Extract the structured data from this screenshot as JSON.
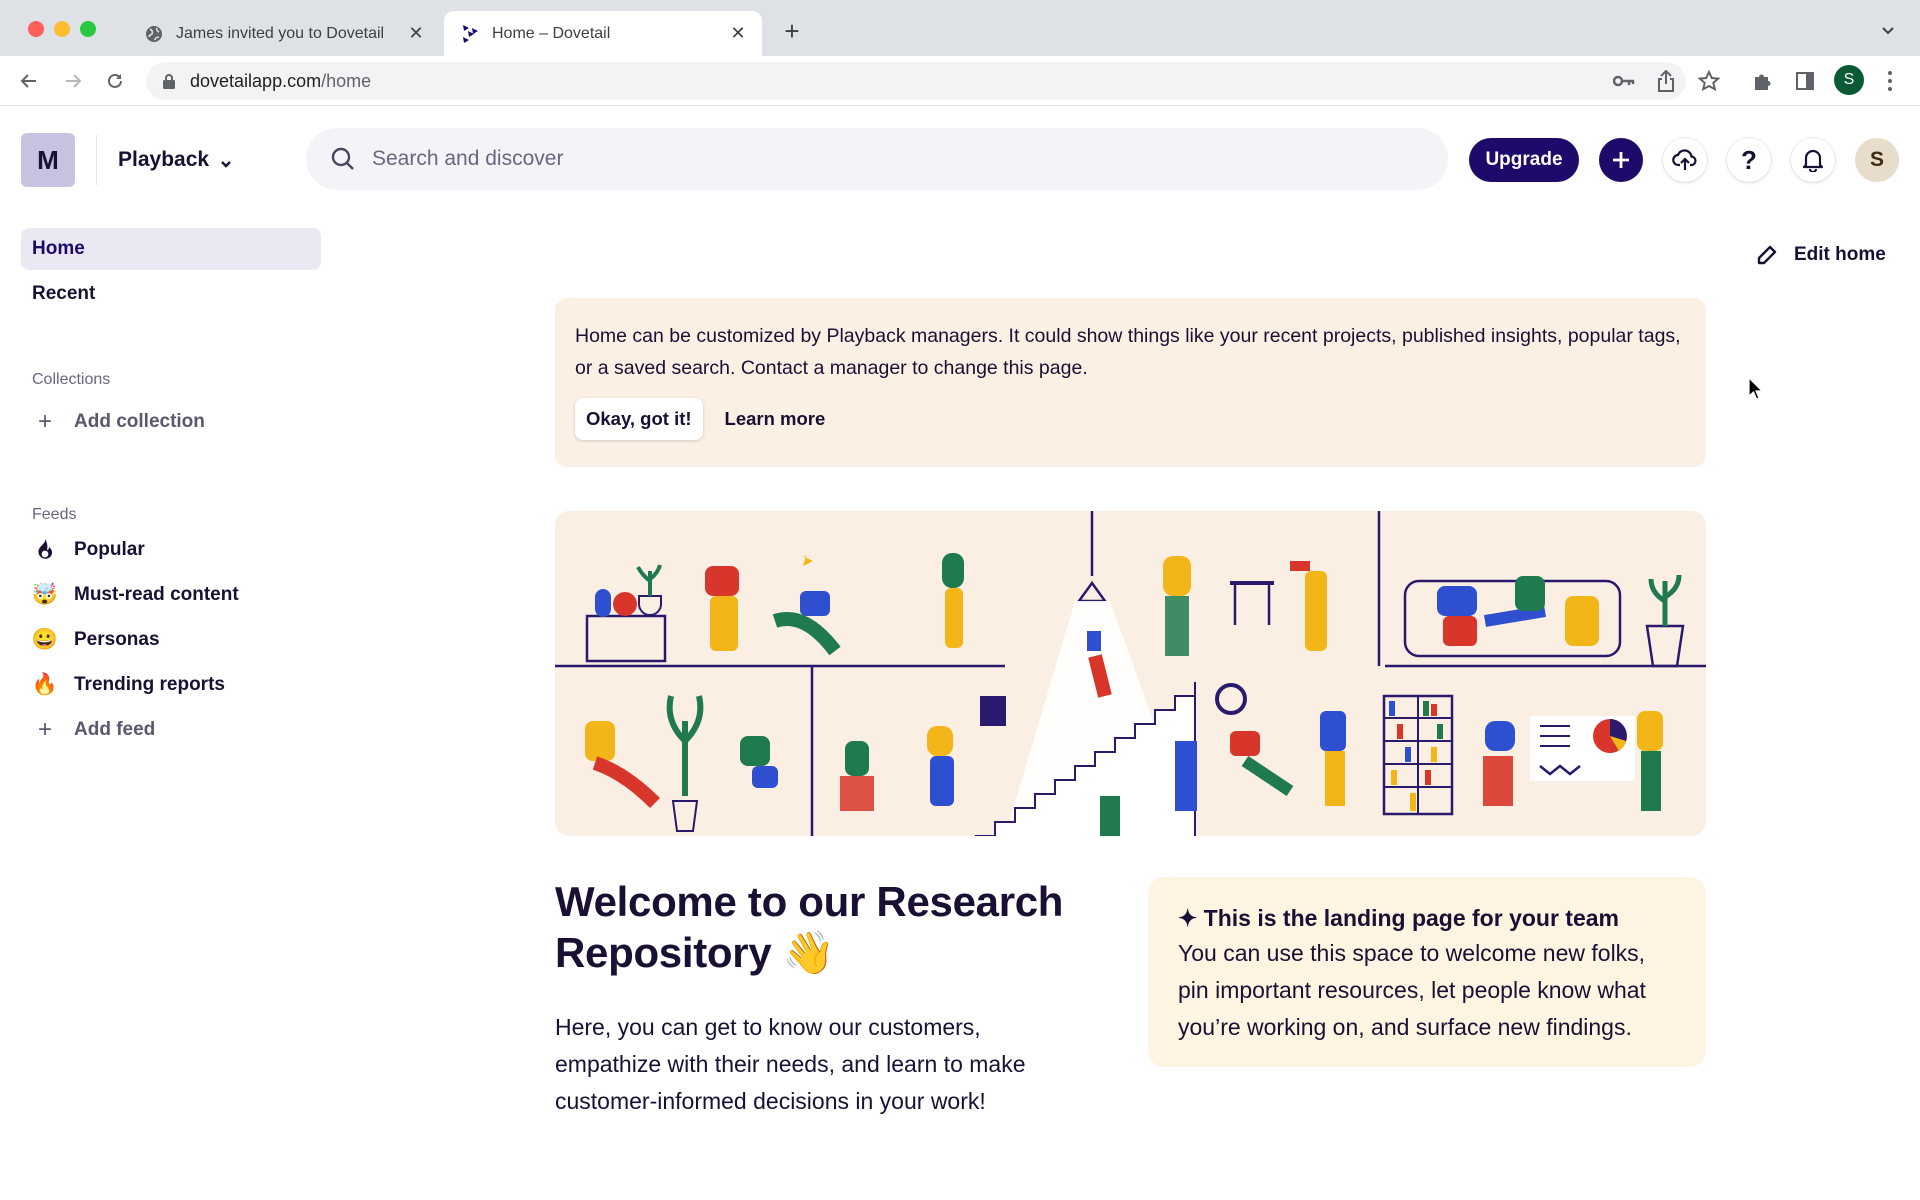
{
  "browser": {
    "tabs": [
      {
        "title": "James invited you to Dovetail",
        "favicon": "globe-icon",
        "active": false
      },
      {
        "title": "Home – Dovetail",
        "favicon": "dovetail-logo-icon",
        "active": true
      }
    ],
    "url_domain": "dovetailapp.com",
    "url_path": "/home",
    "profile_initial": "S"
  },
  "header": {
    "workspace_initial": "M",
    "workspace_name": "Playback",
    "search_placeholder": "Search and discover",
    "upgrade_label": "Upgrade",
    "help_glyph": "?",
    "user_initial": "S"
  },
  "sidebar": {
    "nav": [
      {
        "label": "Home",
        "active": true
      },
      {
        "label": "Recent",
        "active": false
      }
    ],
    "collections_label": "Collections",
    "add_collection_label": "Add collection",
    "feeds_label": "Feeds",
    "feeds": [
      {
        "label": "Popular",
        "icon": "flame-outline-icon",
        "glyph": ""
      },
      {
        "label": "Must-read content",
        "icon": "exploding-head-emoji",
        "glyph": "🤯"
      },
      {
        "label": "Personas",
        "icon": "grinning-face-emoji",
        "glyph": "😀"
      },
      {
        "label": "Trending reports",
        "icon": "fire-emoji",
        "glyph": "🔥"
      }
    ],
    "add_feed_label": "Add feed"
  },
  "main": {
    "edit_home_label": "Edit home",
    "banner": {
      "text": "Home can be customized by Playback managers. It could show things like your recent projects, published insights, popular tags, or a saved search. Contact a manager to change this page.",
      "ok_label": "Okay, got it!",
      "learn_more_label": "Learn more"
    },
    "welcome_title": "Welcome to our Research Repository 👋",
    "welcome_body": "Here, you can get to know our customers, empathize with their needs, and learn to make customer-informed decisions in your work!",
    "landing_card": {
      "title": "✦ This is the landing page for your team",
      "body": "You can use this space to welcome new folks, pin important resources, let people know what you’re working on, and surface new findings."
    },
    "colors": {
      "brand": "#1e0a6b",
      "banner_bg": "#fbf0e3",
      "card_bg": "#fdf4e1",
      "illustration_bg": "#fbeee2"
    }
  }
}
